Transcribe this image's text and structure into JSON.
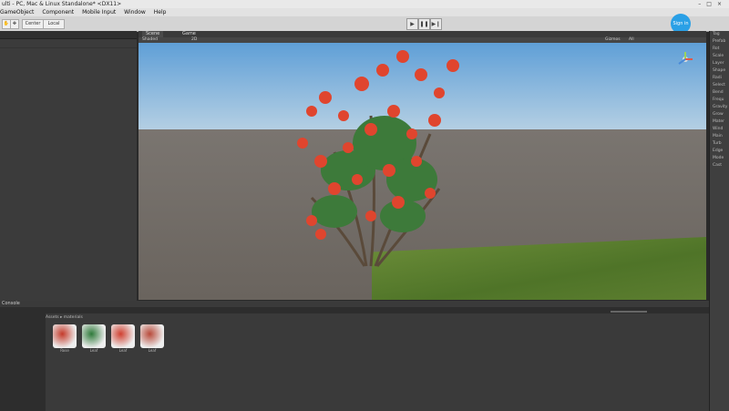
{
  "window": {
    "title": "ulti - PC, Mac & Linux Standalone* <DX11>",
    "controls": [
      "–",
      "□",
      "×"
    ]
  },
  "menu": [
    "GameObject",
    "Component",
    "Mobile Input",
    "Window",
    "Help"
  ],
  "toolbar": {
    "center_label": "Center",
    "local_label": "Local",
    "play_icon": "play-icon",
    "pause_icon": "pause-icon",
    "step_icon": "step-icon"
  },
  "account": {
    "label": "Sign in"
  },
  "tabs": {
    "scene": "Scene",
    "game": "Game"
  },
  "scene_bar": {
    "shaded": "Shaded",
    "mode": "2D",
    "gizmos": "Gizmos",
    "search": "All"
  },
  "inspector": {
    "rows": [
      "Tag",
      "Prefab",
      "Rot",
      "Scale",
      "Layer",
      "Shape",
      "Radi",
      "Select",
      "Bend",
      "Frequ",
      "Gravity",
      "Grow",
      "Mater",
      "Wind",
      "Main",
      "Turb",
      "Edge",
      "Mode",
      "Cast"
    ]
  },
  "bottom": {
    "console_tab": "Console",
    "breadcrumb": "Assets ▸ materials"
  },
  "assets": [
    {
      "name": "Rose",
      "color": "#c43a2a"
    },
    {
      "name": "Leaf",
      "color": "#2e7a3a"
    },
    {
      "name": "Leaf",
      "color": "#d04030"
    },
    {
      "name": "Leaf",
      "color": "#b84a3a"
    }
  ]
}
